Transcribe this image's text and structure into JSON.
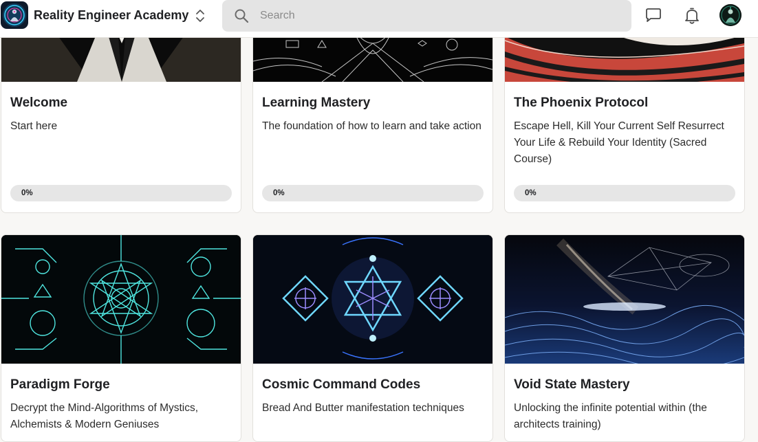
{
  "header": {
    "title": "Reality Engineer Academy",
    "search_placeholder": "Search"
  },
  "courses": [
    {
      "title": "Welcome",
      "description": "Start here",
      "progress_label": "0%",
      "progress": 0
    },
    {
      "title": "Learning Mastery",
      "description": "The foundation of how to learn and take action",
      "progress_label": "0%",
      "progress": 0
    },
    {
      "title": "The Phoenix Protocol",
      "description": "Escape Hell, Kill Your Current Self Resurrect Your Life & Rebuild Your Identity (Sacred Course)",
      "progress_label": "0%",
      "progress": 0
    },
    {
      "title": "Paradigm Forge",
      "description": "Decrypt the Mind-Algorithms of Mystics, Alchemists & Modern Geniuses"
    },
    {
      "title": "Cosmic Command Codes",
      "description": "Bread And Butter manifestation techniques"
    },
    {
      "title": "Void State Mastery",
      "description": "Unlocking the infinite potential within (the architects training)"
    }
  ],
  "colors": {
    "page_bg": "#f8f7f5",
    "search_bg": "#e4e4e4",
    "progress_track": "#e6e6e6"
  }
}
